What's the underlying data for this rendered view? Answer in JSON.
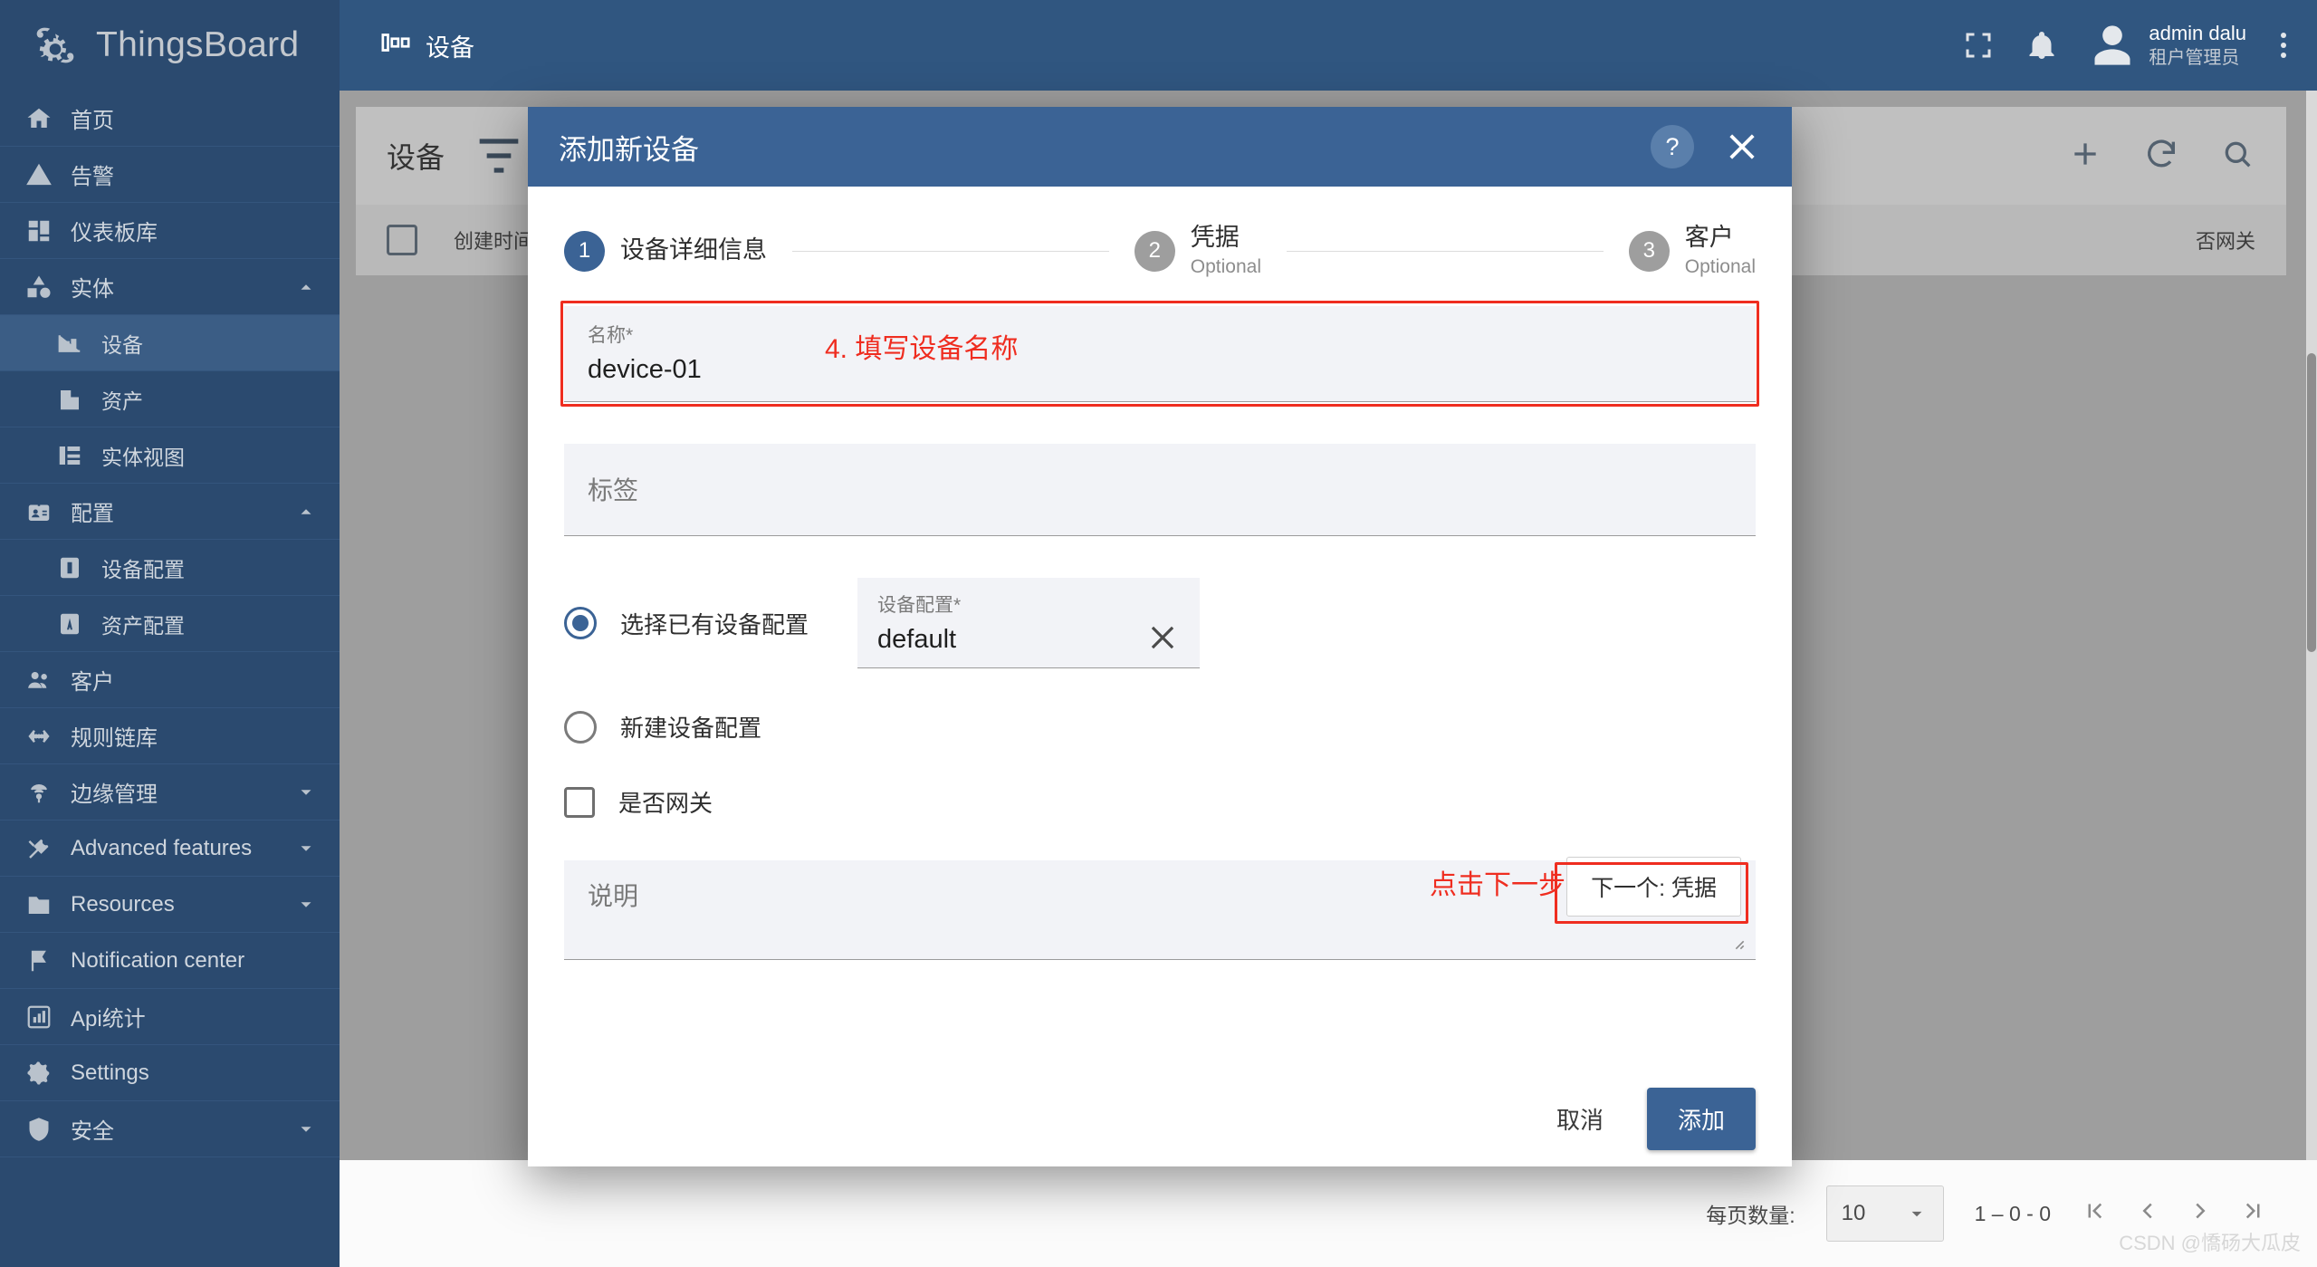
{
  "app": {
    "brand": "ThingsBoard",
    "page_title": "设备"
  },
  "topbar": {
    "user_name": "admin dalu",
    "user_role": "租户管理员",
    "fullscreen_icon": "fullscreen-icon",
    "bell_icon": "notification-bell-icon",
    "avatar_icon": "user-avatar-icon",
    "menu_icon": "more-vertical-icon"
  },
  "sidebar": {
    "items": [
      {
        "label": "首页",
        "icon": "home-icon",
        "level": 0,
        "active": false,
        "caret": ""
      },
      {
        "label": "告警",
        "icon": "alarm-warning-icon",
        "level": 0,
        "active": false,
        "caret": ""
      },
      {
        "label": "仪表板库",
        "icon": "dashboard-grid-icon",
        "level": 0,
        "active": false,
        "caret": ""
      },
      {
        "label": "实体",
        "icon": "entity-shapes-icon",
        "level": 0,
        "active": false,
        "caret": "up"
      },
      {
        "label": "设备",
        "icon": "device-icon",
        "level": 1,
        "active": true,
        "caret": ""
      },
      {
        "label": "资产",
        "icon": "asset-building-icon",
        "level": 1,
        "active": false,
        "caret": ""
      },
      {
        "label": "实体视图",
        "icon": "entity-view-icon",
        "level": 1,
        "active": false,
        "caret": ""
      },
      {
        "label": "配置",
        "icon": "profile-card-icon",
        "level": 0,
        "active": false,
        "caret": "up"
      },
      {
        "label": "设备配置",
        "icon": "device-profile-icon",
        "level": 1,
        "active": false,
        "caret": ""
      },
      {
        "label": "资产配置",
        "icon": "asset-profile-icon",
        "level": 1,
        "active": false,
        "caret": ""
      },
      {
        "label": "客户",
        "icon": "customers-icon",
        "level": 0,
        "active": false,
        "caret": ""
      },
      {
        "label": "规则链库",
        "icon": "rule-chain-icon",
        "level": 0,
        "active": false,
        "caret": ""
      },
      {
        "label": "边缘管理",
        "icon": "edge-icon",
        "level": 0,
        "active": false,
        "caret": "down"
      },
      {
        "label": "Advanced features",
        "icon": "tools-icon",
        "level": 0,
        "active": false,
        "caret": "down"
      },
      {
        "label": "Resources",
        "icon": "folder-icon",
        "level": 0,
        "active": false,
        "caret": "down"
      },
      {
        "label": "Notification center",
        "icon": "flag-icon",
        "level": 0,
        "active": false,
        "caret": ""
      },
      {
        "label": "Api统计",
        "icon": "api-usage-icon",
        "level": 0,
        "active": false,
        "caret": ""
      },
      {
        "label": "Settings",
        "icon": "gear-icon",
        "level": 0,
        "active": false,
        "caret": ""
      },
      {
        "label": "安全",
        "icon": "shield-icon",
        "level": 0,
        "active": false,
        "caret": "down"
      }
    ]
  },
  "page": {
    "title": "设备",
    "filter_icon": "filter-icon",
    "add_icon": "plus-icon",
    "refresh_icon": "refresh-icon",
    "search_icon": "search-icon",
    "columns": [
      "创建时间",
      "否网关"
    ],
    "paging": {
      "rows_label": "每页数量:",
      "rows_value": "10",
      "range": "1 – 0 - 0",
      "first_icon": "first-page-icon",
      "prev_icon": "prev-page-icon",
      "next_icon": "next-page-icon",
      "last_icon": "last-page-icon"
    },
    "watermark": "CSDN @憍砀大瓜皮"
  },
  "modal": {
    "title": "添加新设备",
    "help_icon": "help-icon",
    "close_icon": "close-icon",
    "steps": [
      {
        "num": "1",
        "label": "设备详细信息",
        "sub": "",
        "active": true
      },
      {
        "num": "2",
        "label": "凭据",
        "sub": "Optional",
        "active": false
      },
      {
        "num": "3",
        "label": "客户",
        "sub": "Optional",
        "active": false
      }
    ],
    "name_field": {
      "label": "名称*",
      "value": "device-01"
    },
    "label_field": {
      "placeholder": "标签"
    },
    "radio_existing": {
      "label": "选择已有设备配置",
      "selected": true
    },
    "profile_field": {
      "label": "设备配置*",
      "value": "default",
      "clear_icon": "clear-x-icon"
    },
    "radio_new": {
      "label": "新建设备配置",
      "selected": false
    },
    "gateway_checkbox": {
      "label": "是否网关",
      "checked": false
    },
    "description_field": {
      "placeholder": "说明"
    },
    "next_button": "下一个: 凭据",
    "cancel_button": "取消",
    "submit_button": "添加"
  },
  "annotations": [
    {
      "text": "4. 填写设备名称",
      "color": "#ef2d20"
    },
    {
      "text": "点击下一步",
      "color": "#ef2d20"
    }
  ],
  "colors": {
    "sidebar_bg": "#2b4a6f",
    "topbar_bg": "#305680",
    "accent": "#3b6395",
    "annotation_red": "#ef2d20"
  }
}
